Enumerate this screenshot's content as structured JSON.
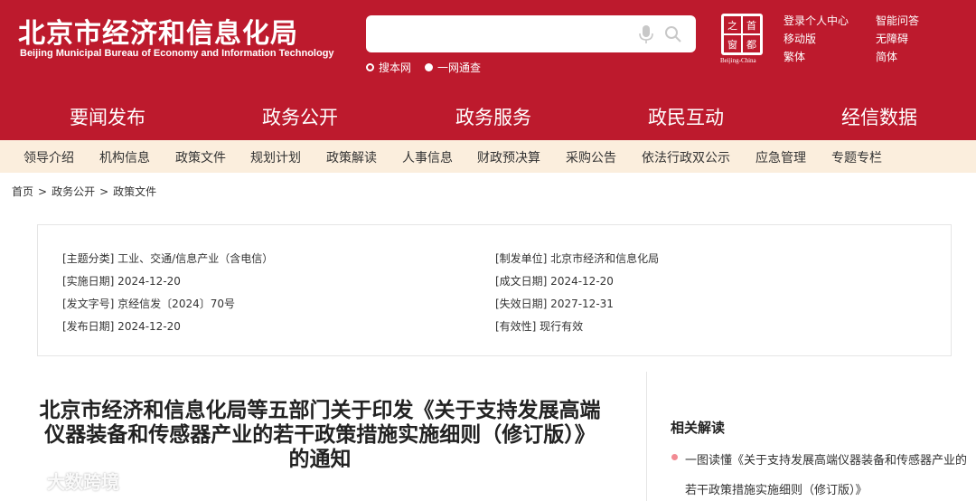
{
  "header": {
    "title": "北京市经济和信息化局",
    "subtitle": "Beijing Municipal Bureau of Economy and Information Technology",
    "search": {
      "placeholder": ""
    },
    "scope_options": [
      "搜本网",
      "一网通查"
    ],
    "seal": {
      "chars": [
        "首",
        "都",
        "之",
        "窗"
      ],
      "caption": "Beijing-China"
    },
    "utility_links": [
      "登录个人中心",
      "智能问答",
      "移动版",
      "无障碍",
      "繁体",
      "简体"
    ]
  },
  "main_nav": [
    "要闻发布",
    "政务公开",
    "政务服务",
    "政民互动",
    "经信数据"
  ],
  "sub_nav": [
    "领导介绍",
    "机构信息",
    "政策文件",
    "规划计划",
    "政策解读",
    "人事信息",
    "财政预决算",
    "采购公告",
    "依法行政双公示",
    "应急管理",
    "专题专栏"
  ],
  "breadcrumb": [
    "首页",
    "政务公开",
    "政策文件"
  ],
  "meta": {
    "topic": "[主题分类] 工业、交通/信息产业（含电信）",
    "issuer": "[制发单位] 北京市经济和信息化局",
    "effective": "[实施日期] 2024-12-20",
    "written": "[成文日期] 2024-12-20",
    "doc_no": "[发文字号] 京经信发〔2024〕70号",
    "expiry": "[失效日期] 2027-12-31",
    "published": "[发布日期] 2024-12-20",
    "validity": "[有效性] 现行有效"
  },
  "article": {
    "title_lines": [
      "北京市经济和信息化局等五部门关于印发《关于支持发展高端",
      "仪器装备和传感器产业的若干政策措施实施细则（修订版）》",
      "的通知"
    ]
  },
  "related": {
    "heading": "相关解读",
    "items": [
      "一图读懂《关于支持发展高端仪器装备和传感器产业的若干政策措施实施细则（修订版）》"
    ]
  },
  "watermark": {
    "text": "大数跨境"
  },
  "colors": {
    "brand_red": "#bd1a2d",
    "subnav_bg": "#fbeedd"
  }
}
